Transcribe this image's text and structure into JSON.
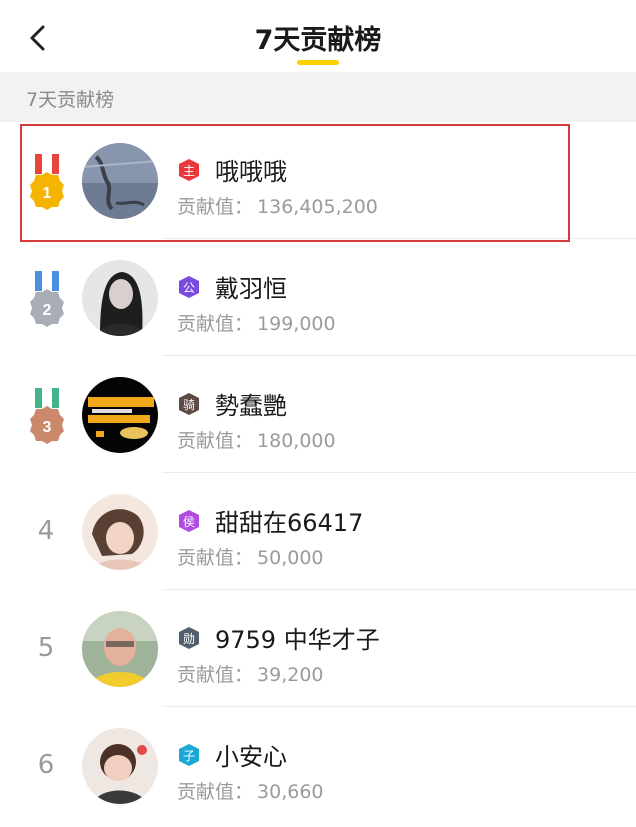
{
  "header": {
    "title": "7天贡献榜",
    "back_icon": "chevron-left-icon",
    "accent_color": "#FFD000"
  },
  "section": {
    "label": "7天贡献榜"
  },
  "contribution_label": "贡献值：",
  "rows": [
    {
      "rank": "1",
      "name": "哦哦哦",
      "badge_text": "主",
      "value": "136,405,200"
    },
    {
      "rank": "2",
      "name": "戴羽恒",
      "badge_text": "公",
      "value": "199,000"
    },
    {
      "rank": "3",
      "name": "勢蠢艷",
      "badge_text": "骑",
      "value": "180,000"
    },
    {
      "rank": "4",
      "name": "甜甜在66417",
      "badge_text": "侯",
      "value": "50,000"
    },
    {
      "rank": "5",
      "name": "9759 中华才子",
      "badge_text": "勋",
      "value": "39,200"
    },
    {
      "rank": "6",
      "name": "小安心",
      "badge_text": "子",
      "value": "30,660"
    }
  ],
  "colors": {
    "gold": "#F5B400",
    "silver": "#A9AEB6",
    "bronze": "#C9896A",
    "badge_red": "#E8363B",
    "badge_purple": "#7B4BE0",
    "badge_brown": "#5C4A45",
    "badge_magenta": "#B04BE0",
    "badge_slate": "#52606E",
    "badge_cyan": "#1AA9D6",
    "highlight_border": "#D9383A"
  }
}
